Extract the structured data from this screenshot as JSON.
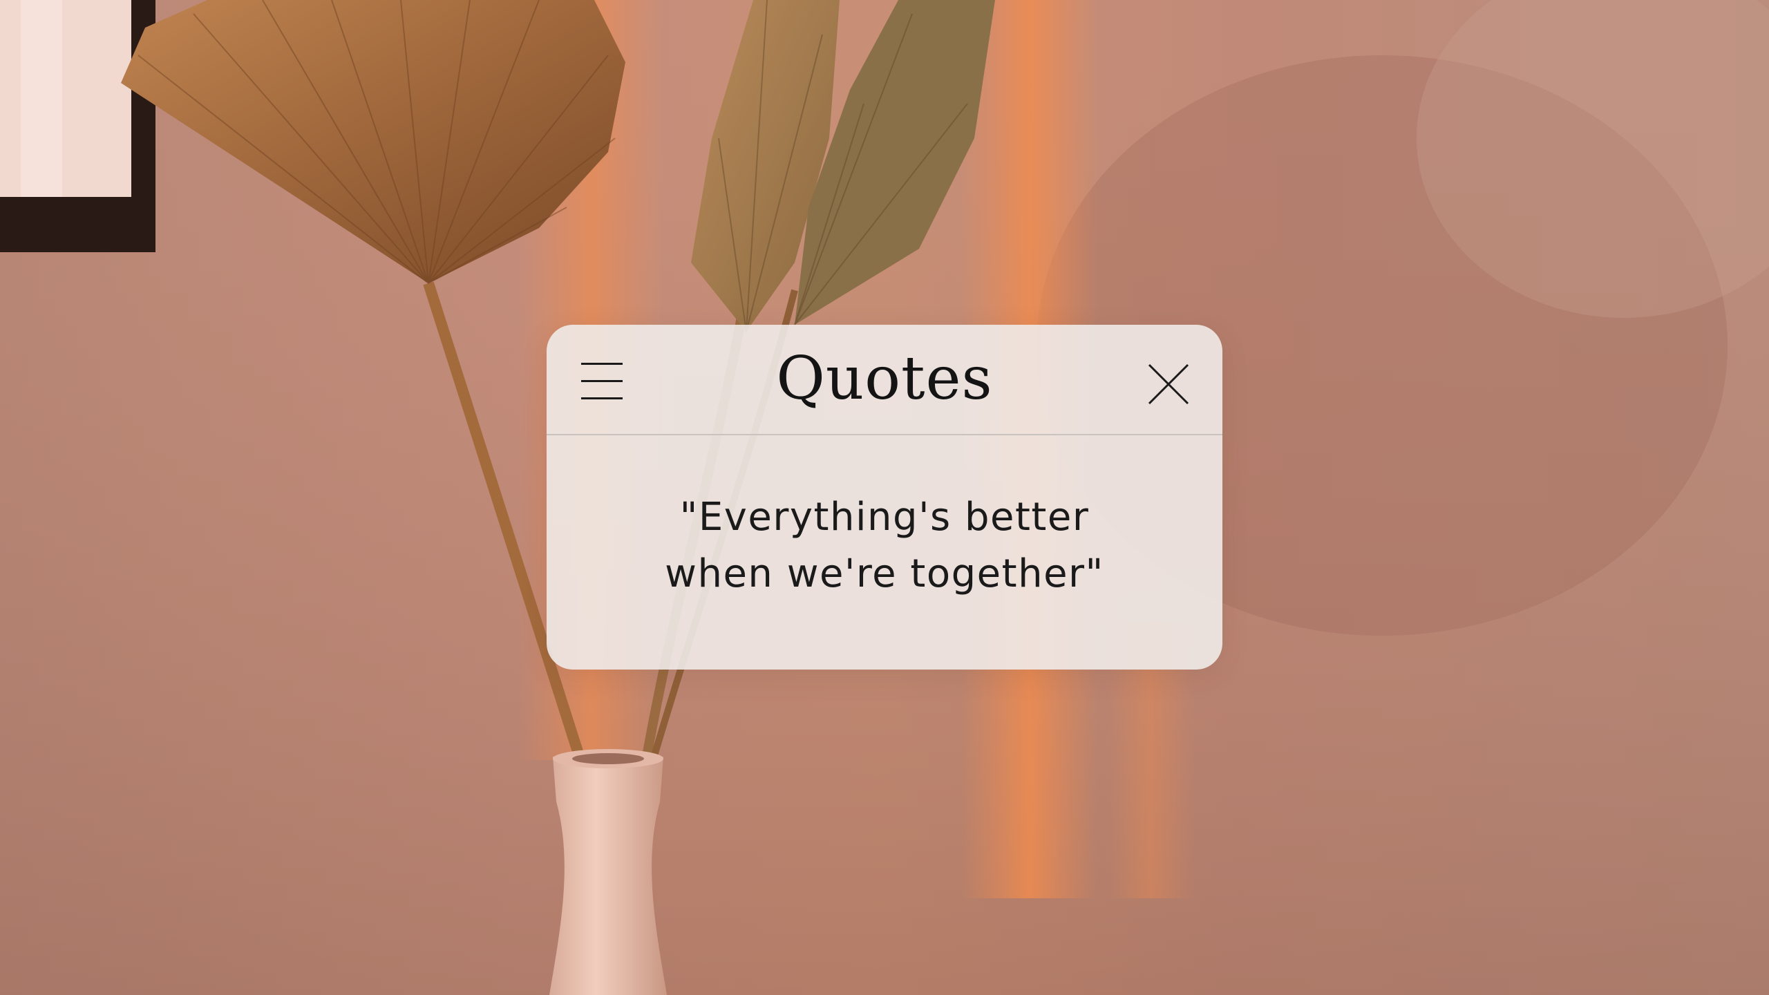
{
  "widget": {
    "title": "Quotes",
    "quote_lines": [
      "\"Everything's better",
      "when we're together\""
    ],
    "menu_icon": "hamburger-menu-icon",
    "close_icon": "close-icon"
  },
  "colors": {
    "wall": "#c48e7a",
    "sunlight": "#e98a55",
    "leaf": "#a06a3c",
    "vase": "#e8c2b2",
    "card": "#f0eae8",
    "text": "#141414"
  }
}
